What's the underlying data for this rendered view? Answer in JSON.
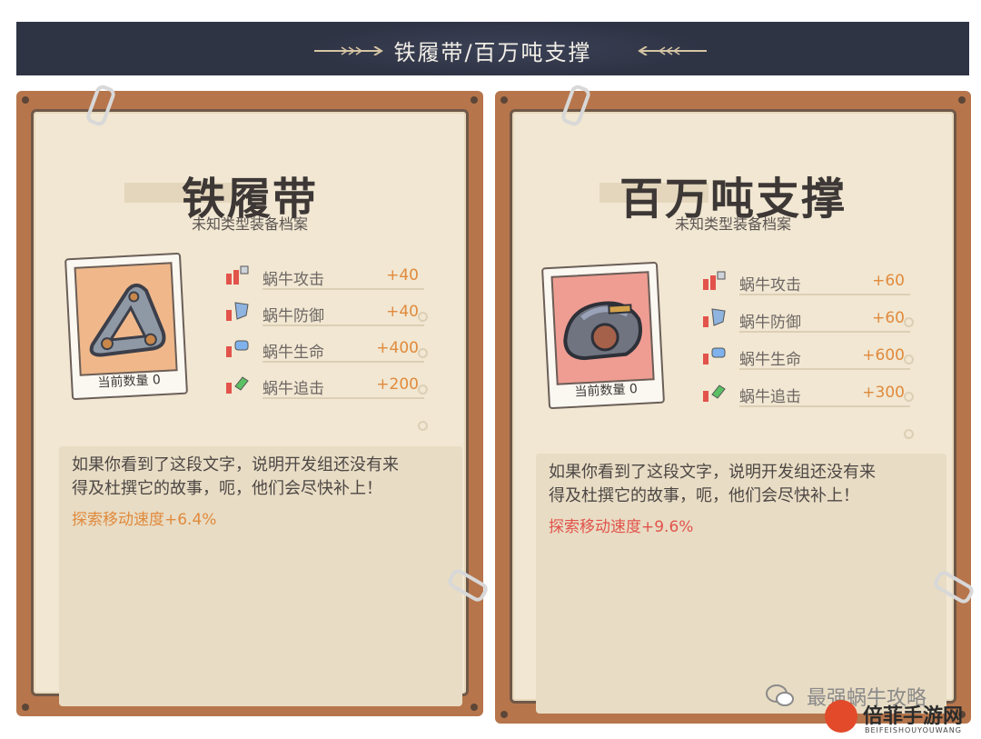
{
  "header": {
    "title": "铁履带/百万吨支撑"
  },
  "cards": [
    {
      "name": "铁履带",
      "subtitle": "未知类型装备档案",
      "count_label": "当前数量",
      "count": "0",
      "photo_bg": "#f0b88a",
      "stats": [
        {
          "icon": "attack-icon",
          "label": "蜗牛攻击",
          "value": "+40"
        },
        {
          "icon": "defense-icon",
          "label": "蜗牛防御",
          "value": "+40"
        },
        {
          "icon": "health-icon",
          "label": "蜗牛生命",
          "value": "+400"
        },
        {
          "icon": "pursuit-icon",
          "label": "蜗牛追击",
          "value": "+200"
        }
      ],
      "description_line1": "如果你看到了这段文字，说明开发组还没有来",
      "description_line2": "得及杜撰它的故事，呃，他们会尽快补上！",
      "bonus": "探索移动速度+6.4%",
      "bonus_color": "#e08a3d"
    },
    {
      "name": "百万吨支撑",
      "subtitle": "未知类型装备档案",
      "count_label": "当前数量",
      "count": "0",
      "photo_bg": "#ef9d92",
      "stats": [
        {
          "icon": "attack-icon",
          "label": "蜗牛攻击",
          "value": "+60"
        },
        {
          "icon": "defense-icon",
          "label": "蜗牛防御",
          "value": "+60"
        },
        {
          "icon": "health-icon",
          "label": "蜗牛生命",
          "value": "+600"
        },
        {
          "icon": "pursuit-icon",
          "label": "蜗牛追击",
          "value": "+300"
        }
      ],
      "description_line1": "如果你看到了这段文字，说明开发组还没有来",
      "description_line2": "得及杜撰它的故事，呃，他们会尽快补上！",
      "bonus": "探索移动速度+9.6%",
      "bonus_color": "#e2534b"
    }
  ],
  "watermark": {
    "account": "最强蜗牛攻略",
    "site_name": "倍菲手游网",
    "site_sub": "BEIFEISHOUYOUWANG"
  }
}
